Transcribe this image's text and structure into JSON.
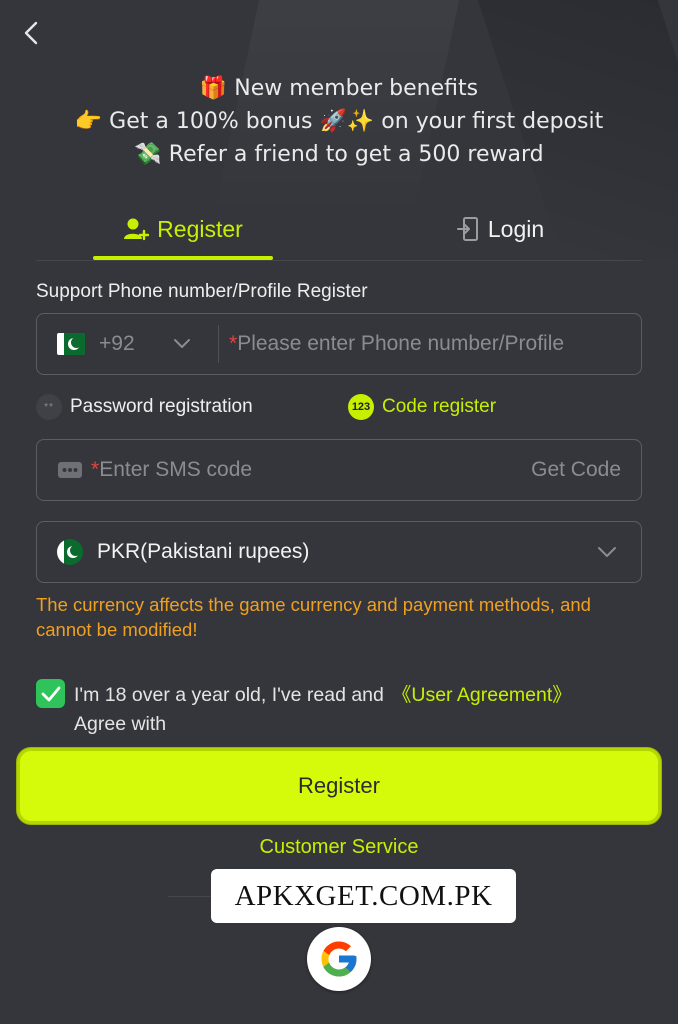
{
  "benefits": {
    "line1": "🎁 New member benefits",
    "line2": "👉 Get a 100% bonus 🚀✨ on your first deposit",
    "line3": "💸 Refer a friend to get a 500 reward"
  },
  "tabs": {
    "register": "Register",
    "login": "Login"
  },
  "form": {
    "section_label": "Support Phone number/Profile Register",
    "country_code": "+92",
    "phone_required_mark": "*",
    "phone_placeholder": "Please enter Phone number/Profile",
    "mode_password": "Password registration",
    "mode_code": "Code register",
    "mode_code_badge": "123",
    "mode_password_icon_text": "**",
    "sms_required_mark": "*",
    "sms_placeholder": "Enter SMS code",
    "get_code": "Get Code",
    "currency": "PKR(Pakistani rupees)",
    "currency_warning": "The currency affects the game currency and payment methods, and cannot be modified!",
    "agree_text": "I'm 18 over a year old, I've read and",
    "agree_link": "《User Agreement》",
    "agree_tail": "Agree with",
    "agree_checked": true,
    "register_button": "Register"
  },
  "footer": {
    "customer_service": "Customer Service",
    "watermark": "APKXGET.COM.PK"
  },
  "colors": {
    "background": "#34363c",
    "accent": "#c7f000",
    "button": "#d6fb0a",
    "warning": "#f0a020",
    "checkbox": "#2ec45a",
    "required": "#e0453f"
  },
  "icons": {
    "back": "chevron-left-icon",
    "register_tab": "user-plus-icon",
    "login_tab": "door-enter-icon",
    "country_flag": "pakistan-flag-icon",
    "dropdown": "chevron-down-icon",
    "sms": "message-dots-icon",
    "check": "checkmark-icon",
    "google": "google-logo-icon"
  }
}
